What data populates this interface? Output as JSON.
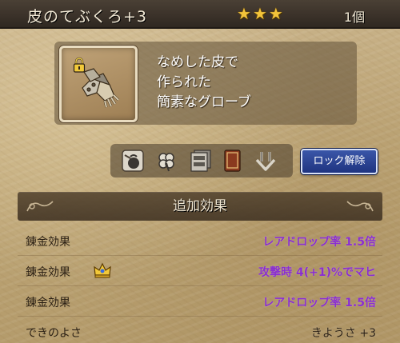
{
  "header": {
    "item_name": "皮のてぶくろ+3",
    "stars": [
      "★",
      "★",
      "★"
    ],
    "count": "1個"
  },
  "item": {
    "image_icon": "leather-gloves-icon",
    "locked_icon": "padlock-icon",
    "description_lines": [
      "なめした皮で",
      "作られた",
      "簡素なグローブ"
    ]
  },
  "actions": {
    "icons": [
      "bag-icon",
      "clover-icon",
      "storage-drawer-icon",
      "book-icon",
      "down-arrows-icon"
    ],
    "unlock_button_label": "ロック解除"
  },
  "effects": {
    "section_title": "追加効果",
    "rows": [
      {
        "label": "錬金効果",
        "value": "レアドロップ率 1.5倍",
        "has_crown": false
      },
      {
        "label": "錬金効果",
        "value": "攻撃時 4(+1)%でマヒ",
        "has_crown": true
      },
      {
        "label": "錬金効果",
        "value": "レアドロップ率 1.5倍",
        "has_crown": false
      },
      {
        "label": "できのよさ",
        "value": "きようさ +3",
        "has_crown": false
      }
    ]
  },
  "colors": {
    "effect_value": "#8a2fd0",
    "star": "#f3c43a",
    "button": "#1f3480"
  }
}
